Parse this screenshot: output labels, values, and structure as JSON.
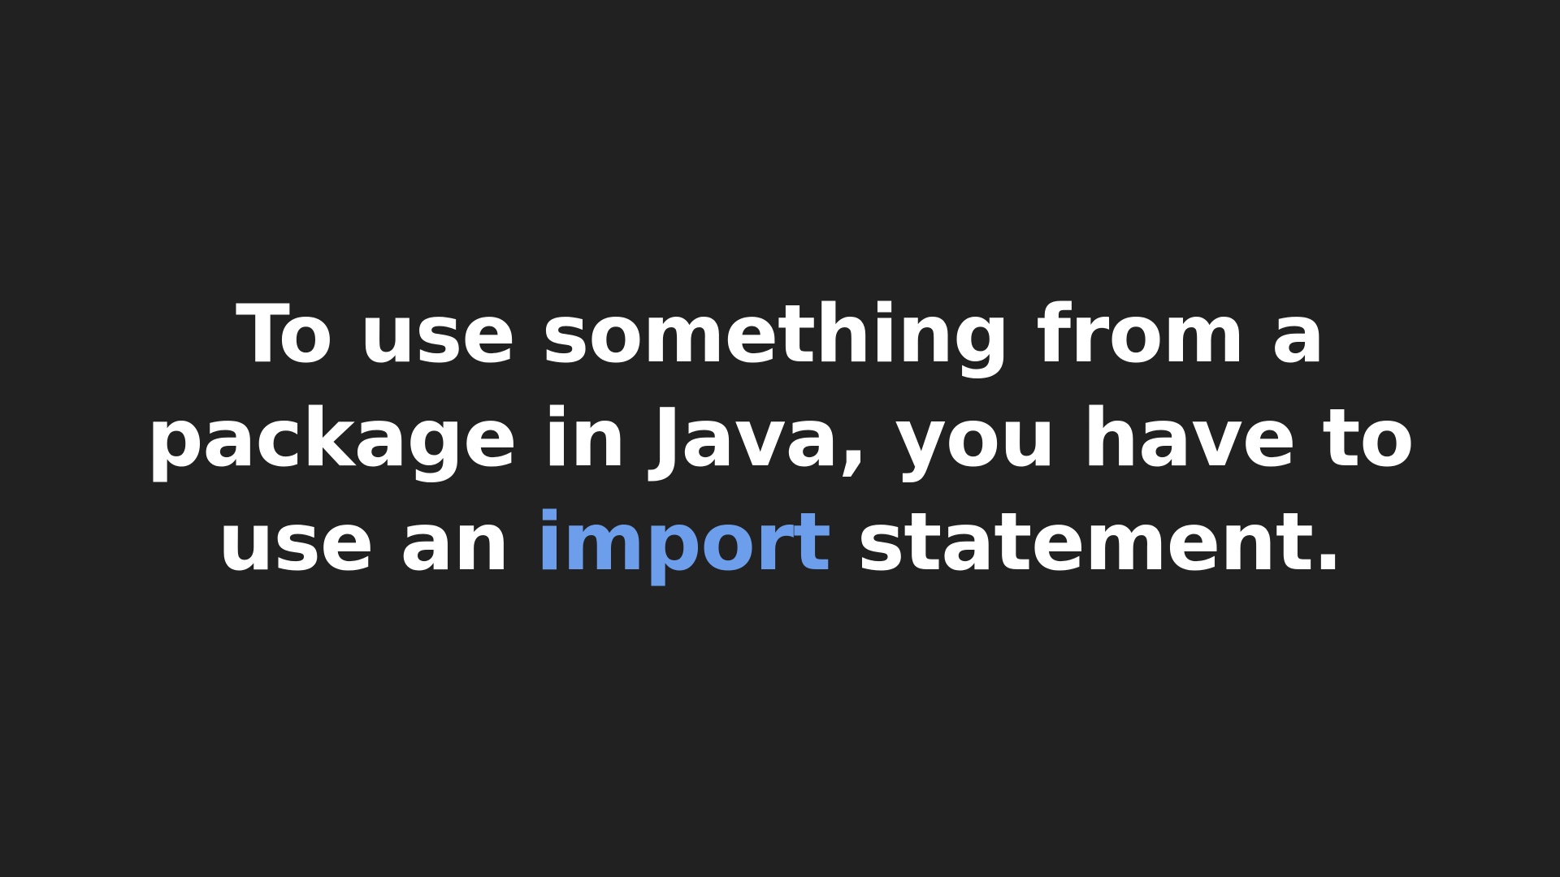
{
  "slide": {
    "text_before": "To use something from a package in Java, you have to use an ",
    "keyword": "import",
    "text_after": " statement.",
    "colors": {
      "background": "#212121",
      "text": "#ffffff",
      "keyword": "#6d9eeb"
    }
  }
}
